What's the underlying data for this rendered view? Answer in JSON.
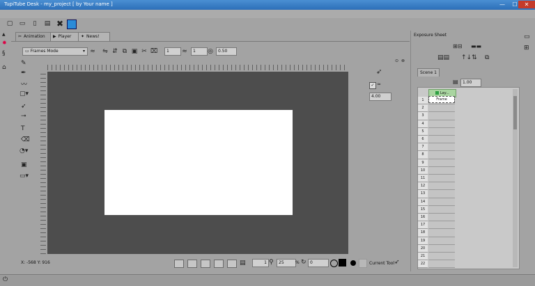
{
  "window": {
    "title": "TupiTube Desk - my_project [ by Your name ]"
  },
  "window_controls": {
    "minimize": "—",
    "maximize": "☐",
    "close": "✕"
  },
  "main_toolbar": {
    "icons": [
      "new-file-icon",
      "open-folder-icon",
      "save-icon",
      "save-as-icon",
      "close-project-icon",
      "animation-mode-icon"
    ]
  },
  "tabs": [
    {
      "label": "Animation",
      "icon": "animation-icon",
      "active": true
    },
    {
      "label": "Player",
      "icon": "play-icon",
      "active": false
    },
    {
      "label": "News!",
      "icon": "twitter-icon",
      "active": false
    }
  ],
  "canvas_toolbar": {
    "mode": "Frames Mode",
    "onion_previous": "1",
    "onion_next": "1",
    "opacity": "0.50"
  },
  "brush_panel": {
    "value": "4.00"
  },
  "status": {
    "coords": "X: -568 Y: 916"
  },
  "bottom_bar": {
    "frame": "1",
    "zoom": "25",
    "zoom_unit": "%",
    "rotation": "0",
    "current_tool_label": "Current Tool"
  },
  "exposure_sheet": {
    "title": "Exposure Sheet",
    "scene_tab": "Scene 1",
    "fps": "1.00",
    "layer_name": "Lay...",
    "first_cell": "Frame",
    "rows": [
      "1",
      "2",
      "3",
      "4",
      "5",
      "6",
      "7",
      "8",
      "9",
      "10",
      "11",
      "12",
      "13",
      "14",
      "15",
      "16",
      "17",
      "18",
      "19",
      "20",
      "21",
      "22"
    ]
  },
  "colors": {
    "titlebar": "#2d6fb8",
    "canvas_bg": "#4d4d4d",
    "paper": "#ffffff",
    "layer_indicator": "#2ea043"
  }
}
